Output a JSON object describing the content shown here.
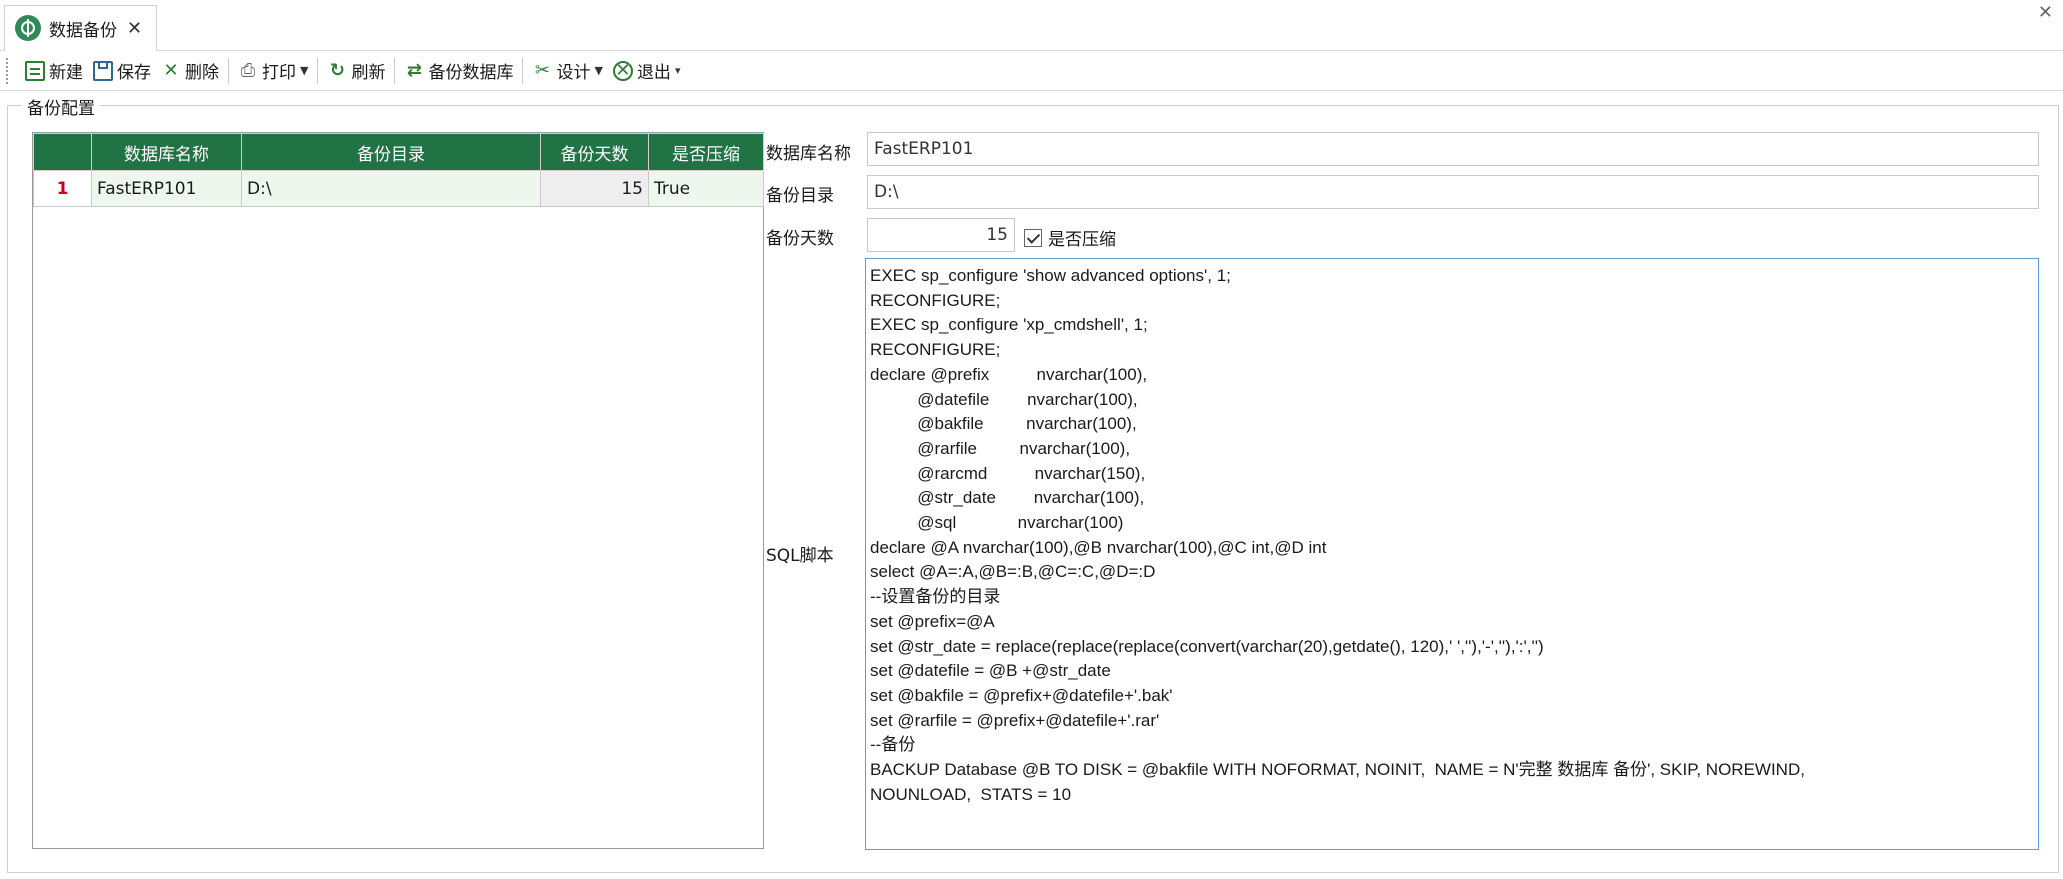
{
  "tab": {
    "title": "数据备份",
    "close": "✕"
  },
  "window": {
    "close": "✕"
  },
  "toolbar": {
    "new": "新建",
    "save": "保存",
    "delete": "删除",
    "print": "打印",
    "refresh": "刷新",
    "backup_db": "备份数据库",
    "design": "设计",
    "exit": "退出"
  },
  "group": {
    "title": "备份配置"
  },
  "grid": {
    "columns": [
      "数据库名称",
      "备份目录",
      "备份天数",
      "是否压缩"
    ],
    "rows": [
      {
        "num": "1",
        "db": "FastERP101",
        "dir": "D:\\",
        "days": "15",
        "compress": "True"
      }
    ]
  },
  "form": {
    "db_label": "数据库名称",
    "db_value": "FastERP101",
    "dir_label": "备份目录",
    "dir_value": "D:\\",
    "days_label": "备份天数",
    "days_value": "15",
    "compress_label": "是否压缩",
    "compress_checked": true,
    "sql_label": "SQL脚本",
    "sql_text": "EXEC sp_configure 'show advanced options', 1;\nRECONFIGURE;\nEXEC sp_configure 'xp_cmdshell', 1;\nRECONFIGURE;\ndeclare @prefix          nvarchar(100),\n          @datefile        nvarchar(100),\n          @bakfile         nvarchar(100),\n          @rarfile         nvarchar(100),\n          @rarcmd          nvarchar(150),\n          @str_date        nvarchar(100),\n          @sql             nvarchar(100)\ndeclare @A nvarchar(100),@B nvarchar(100),@C int,@D int\nselect @A=:A,@B=:B,@C=:C,@D=:D\n--设置备份的目录\nset @prefix=@A\nset @str_date = replace(replace(replace(convert(varchar(20),getdate(), 120),' ',''),'-',''),':','')\nset @datefile = @B +@str_date\nset @bakfile = @prefix+@datefile+'.bak'\nset @rarfile = @prefix+@datefile+'.rar'\n--备份\nBACKUP Database @B TO DISK = @bakfile WITH NOFORMAT, NOINIT,  NAME = N'完整 数据库 备份', SKIP, NOREWIND,\nNOUNLOAD,  STATS = 10"
  }
}
